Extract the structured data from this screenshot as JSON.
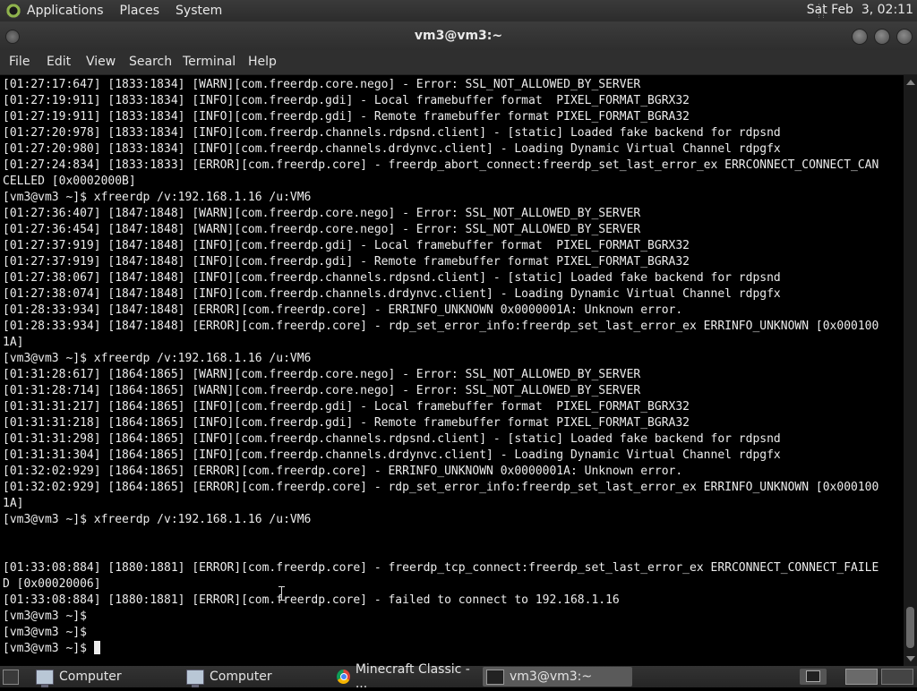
{
  "top_panel": {
    "menus": [
      "Applications",
      "Places",
      "System"
    ],
    "clock": "Sat Feb  3, 02:11"
  },
  "window": {
    "title": "vm3@vm3:~",
    "menus": [
      "File",
      "Edit",
      "View",
      "Search",
      "Terminal",
      "Help"
    ]
  },
  "terminal": {
    "lines": [
      "[01:27:17:647] [1833:1834] [WARN][com.freerdp.core.nego] - Error: SSL_NOT_ALLOWED_BY_SERVER",
      "[01:27:19:911] [1833:1834] [INFO][com.freerdp.gdi] - Local framebuffer format  PIXEL_FORMAT_BGRX32",
      "[01:27:19:911] [1833:1834] [INFO][com.freerdp.gdi] - Remote framebuffer format PIXEL_FORMAT_BGRA32",
      "[01:27:20:978] [1833:1834] [INFO][com.freerdp.channels.rdpsnd.client] - [static] Loaded fake backend for rdpsnd",
      "[01:27:20:980] [1833:1834] [INFO][com.freerdp.channels.drdynvc.client] - Loading Dynamic Virtual Channel rdpgfx",
      "[01:27:24:834] [1833:1833] [ERROR][com.freerdp.core] - freerdp_abort_connect:freerdp_set_last_error_ex ERRCONNECT_CONNECT_CAN",
      "CELLED [0x0002000B]",
      "[vm3@vm3 ~]$ xfreerdp /v:192.168.1.16 /u:VM6",
      "[01:27:36:407] [1847:1848] [WARN][com.freerdp.core.nego] - Error: SSL_NOT_ALLOWED_BY_SERVER",
      "[01:27:36:454] [1847:1848] [WARN][com.freerdp.core.nego] - Error: SSL_NOT_ALLOWED_BY_SERVER",
      "[01:27:37:919] [1847:1848] [INFO][com.freerdp.gdi] - Local framebuffer format  PIXEL_FORMAT_BGRX32",
      "[01:27:37:919] [1847:1848] [INFO][com.freerdp.gdi] - Remote framebuffer format PIXEL_FORMAT_BGRA32",
      "[01:27:38:067] [1847:1848] [INFO][com.freerdp.channels.rdpsnd.client] - [static] Loaded fake backend for rdpsnd",
      "[01:27:38:074] [1847:1848] [INFO][com.freerdp.channels.drdynvc.client] - Loading Dynamic Virtual Channel rdpgfx",
      "[01:28:33:934] [1847:1848] [ERROR][com.freerdp.core] - ERRINFO_UNKNOWN 0x0000001A: Unknown error.",
      "[01:28:33:934] [1847:1848] [ERROR][com.freerdp.core] - rdp_set_error_info:freerdp_set_last_error_ex ERRINFO_UNKNOWN [0x000100",
      "1A]",
      "[vm3@vm3 ~]$ xfreerdp /v:192.168.1.16 /u:VM6",
      "[01:31:28:617] [1864:1865] [WARN][com.freerdp.core.nego] - Error: SSL_NOT_ALLOWED_BY_SERVER",
      "[01:31:28:714] [1864:1865] [WARN][com.freerdp.core.nego] - Error: SSL_NOT_ALLOWED_BY_SERVER",
      "[01:31:31:217] [1864:1865] [INFO][com.freerdp.gdi] - Local framebuffer format  PIXEL_FORMAT_BGRX32",
      "[01:31:31:218] [1864:1865] [INFO][com.freerdp.gdi] - Remote framebuffer format PIXEL_FORMAT_BGRA32",
      "[01:31:31:298] [1864:1865] [INFO][com.freerdp.channels.rdpsnd.client] - [static] Loaded fake backend for rdpsnd",
      "[01:31:31:304] [1864:1865] [INFO][com.freerdp.channels.drdynvc.client] - Loading Dynamic Virtual Channel rdpgfx",
      "[01:32:02:929] [1864:1865] [ERROR][com.freerdp.core] - ERRINFO_UNKNOWN 0x0000001A: Unknown error.",
      "[01:32:02:929] [1864:1865] [ERROR][com.freerdp.core] - rdp_set_error_info:freerdp_set_last_error_ex ERRINFO_UNKNOWN [0x000100",
      "1A]",
      "[vm3@vm3 ~]$ xfreerdp /v:192.168.1.16 /u:VM6",
      "",
      "",
      "[01:33:08:884] [1880:1881] [ERROR][com.freerdp.core] - freerdp_tcp_connect:freerdp_set_last_error_ex ERRCONNECT_CONNECT_FAILE",
      "D [0x00020006]",
      "[01:33:08:884] [1880:1881] [ERROR][com.freerdp.core] - failed to connect to 192.168.1.16",
      "[vm3@vm3 ~]$",
      "[vm3@vm3 ~]$",
      "[vm3@vm3 ~]$ "
    ]
  },
  "taskbar": {
    "tasks": [
      {
        "label": "Computer",
        "icon": "computer-icon",
        "active": false
      },
      {
        "label": "Computer",
        "icon": "computer-icon",
        "active": false
      },
      {
        "label": "Minecraft Classic - ...",
        "icon": "chrome-icon",
        "active": false
      },
      {
        "label": "vm3@vm3:~",
        "icon": "terminal-icon",
        "active": true
      }
    ]
  }
}
